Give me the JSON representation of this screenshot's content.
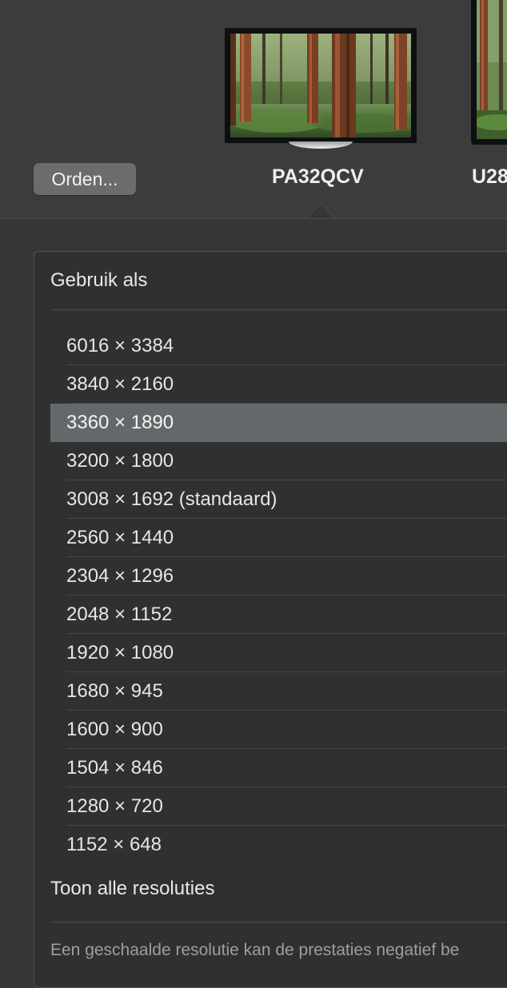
{
  "arrangement": {
    "arrange_button_label": "Orden...",
    "displays": [
      {
        "name": "PA32QCV",
        "selected": true
      },
      {
        "name": "U28"
      }
    ]
  },
  "settings": {
    "use_as_label": "Gebruik als",
    "resolutions": [
      "6016 × 3384",
      "3840 × 2160",
      "3360 × 1890",
      "3200 × 1800",
      "3008 × 1692 (standaard)",
      "2560 × 1440",
      "2304 × 1296",
      "2048 × 1152",
      "1920 × 1080",
      "1680 × 945",
      "1600 × 900",
      "1504 × 846",
      "1280 × 720",
      "1152 × 648"
    ],
    "selected_resolution": "3360 × 1890",
    "show_all_label": "Toon alle resoluties",
    "footnote": "Een geschaalde resolutie kan de prestaties negatief be"
  },
  "colors": {
    "window_background": "#343637",
    "arrangement_background": "#3a3c3e",
    "selected_row": "#65686a",
    "button": "#6a6c6e"
  }
}
